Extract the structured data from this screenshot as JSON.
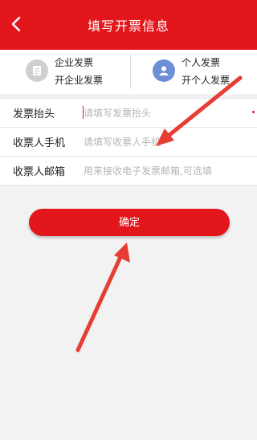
{
  "header": {
    "title": "填写开票信息",
    "back_icon": "chevron-left-icon"
  },
  "invoice_types": [
    {
      "line1": "企业发票",
      "line2": "开企业发票",
      "icon": "document-icon"
    },
    {
      "line1": "个人发票",
      "line2": "开个人发票",
      "icon": "person-icon"
    }
  ],
  "form": {
    "fields": [
      {
        "label": "发票抬头",
        "placeholder": "请填写发票抬头"
      },
      {
        "label": "收票人手机",
        "placeholder": "请填写收票人手机"
      },
      {
        "label": "收票人邮箱",
        "placeholder": "用来接收电子发票邮箱,可选填"
      }
    ]
  },
  "confirm_button": {
    "label": "确定"
  },
  "colors": {
    "brand_red": "#e3161c",
    "gray_icon": "#cfcfcf",
    "blue_icon": "#6c8fd6"
  }
}
